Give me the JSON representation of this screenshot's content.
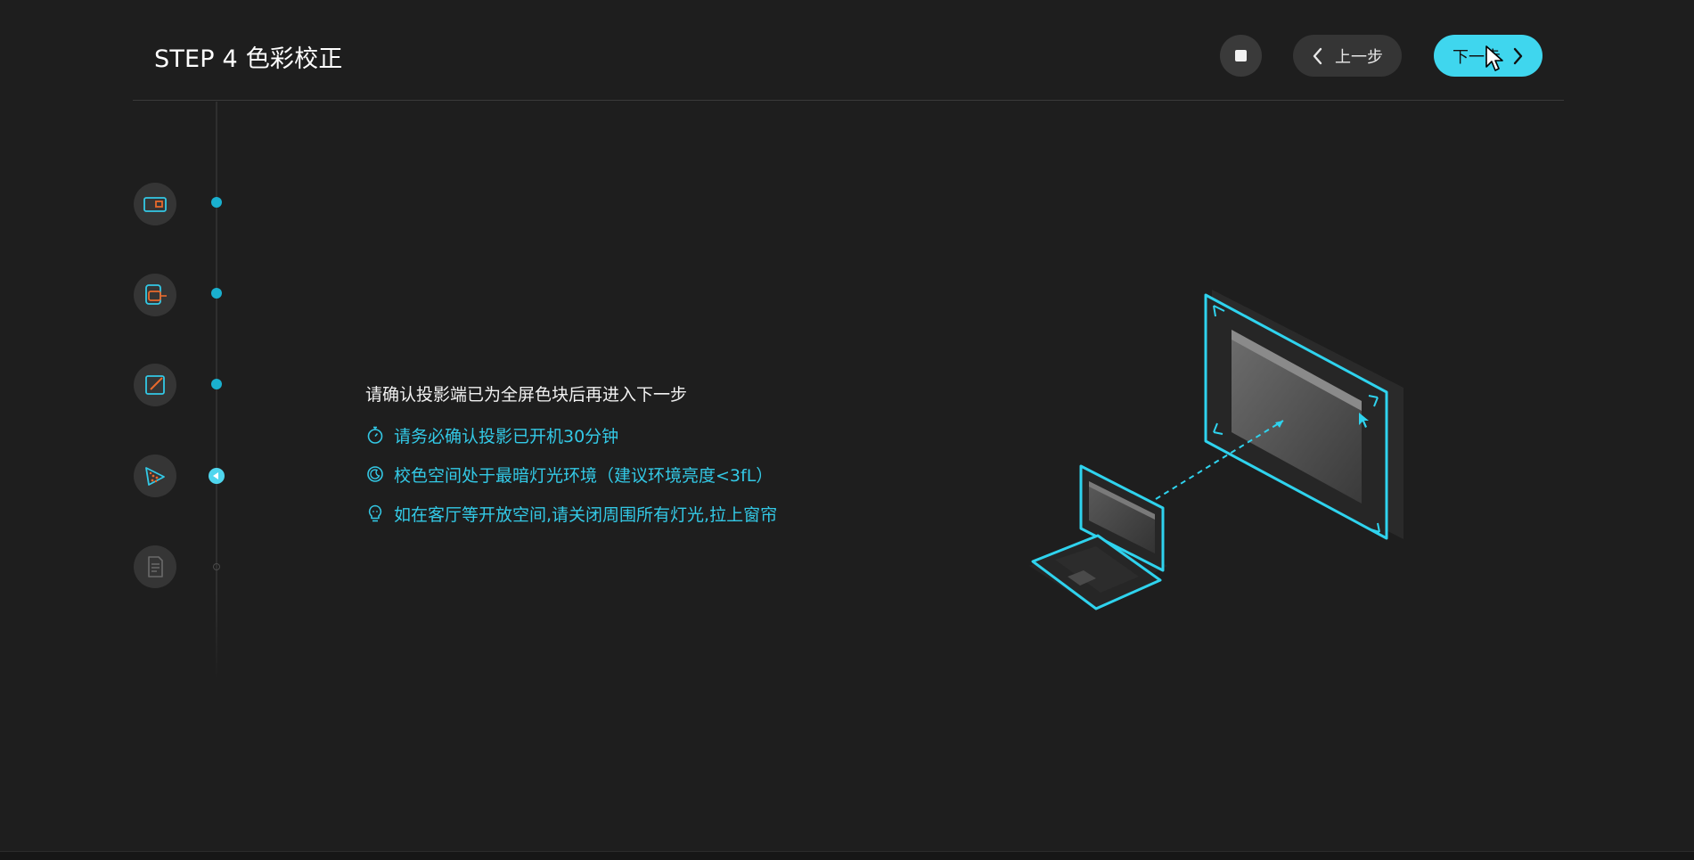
{
  "header": {
    "title": "STEP 4 色彩校正",
    "prev_label": "上一步",
    "next_label": "下一步"
  },
  "steps": [
    {
      "icon": "projector-screen-icon",
      "state": "done"
    },
    {
      "icon": "display-connection-icon",
      "state": "done"
    },
    {
      "icon": "edit-frame-icon",
      "state": "done"
    },
    {
      "icon": "color-gamut-icon",
      "state": "active"
    },
    {
      "icon": "report-document-icon",
      "state": "pending"
    }
  ],
  "content": {
    "main_instruction": "请确认投影端已为全屏色块后再进入下一步",
    "tips": [
      {
        "icon": "stopwatch-icon",
        "text": "请务必确认投影已开机30分钟"
      },
      {
        "icon": "moon-dark-icon",
        "text": "校色空间处于最暗灯光环境（建议环境亮度<3fL）"
      },
      {
        "icon": "lightbulb-icon",
        "text": "如在客厅等开放空间,请关闭周围所有灯光,拉上窗帘"
      }
    ]
  },
  "colors": {
    "background": "#1e1e1e",
    "accent": "#3fd6ee",
    "accent_text": "#33c9e6",
    "step_icon_orange": "#e8692c"
  }
}
